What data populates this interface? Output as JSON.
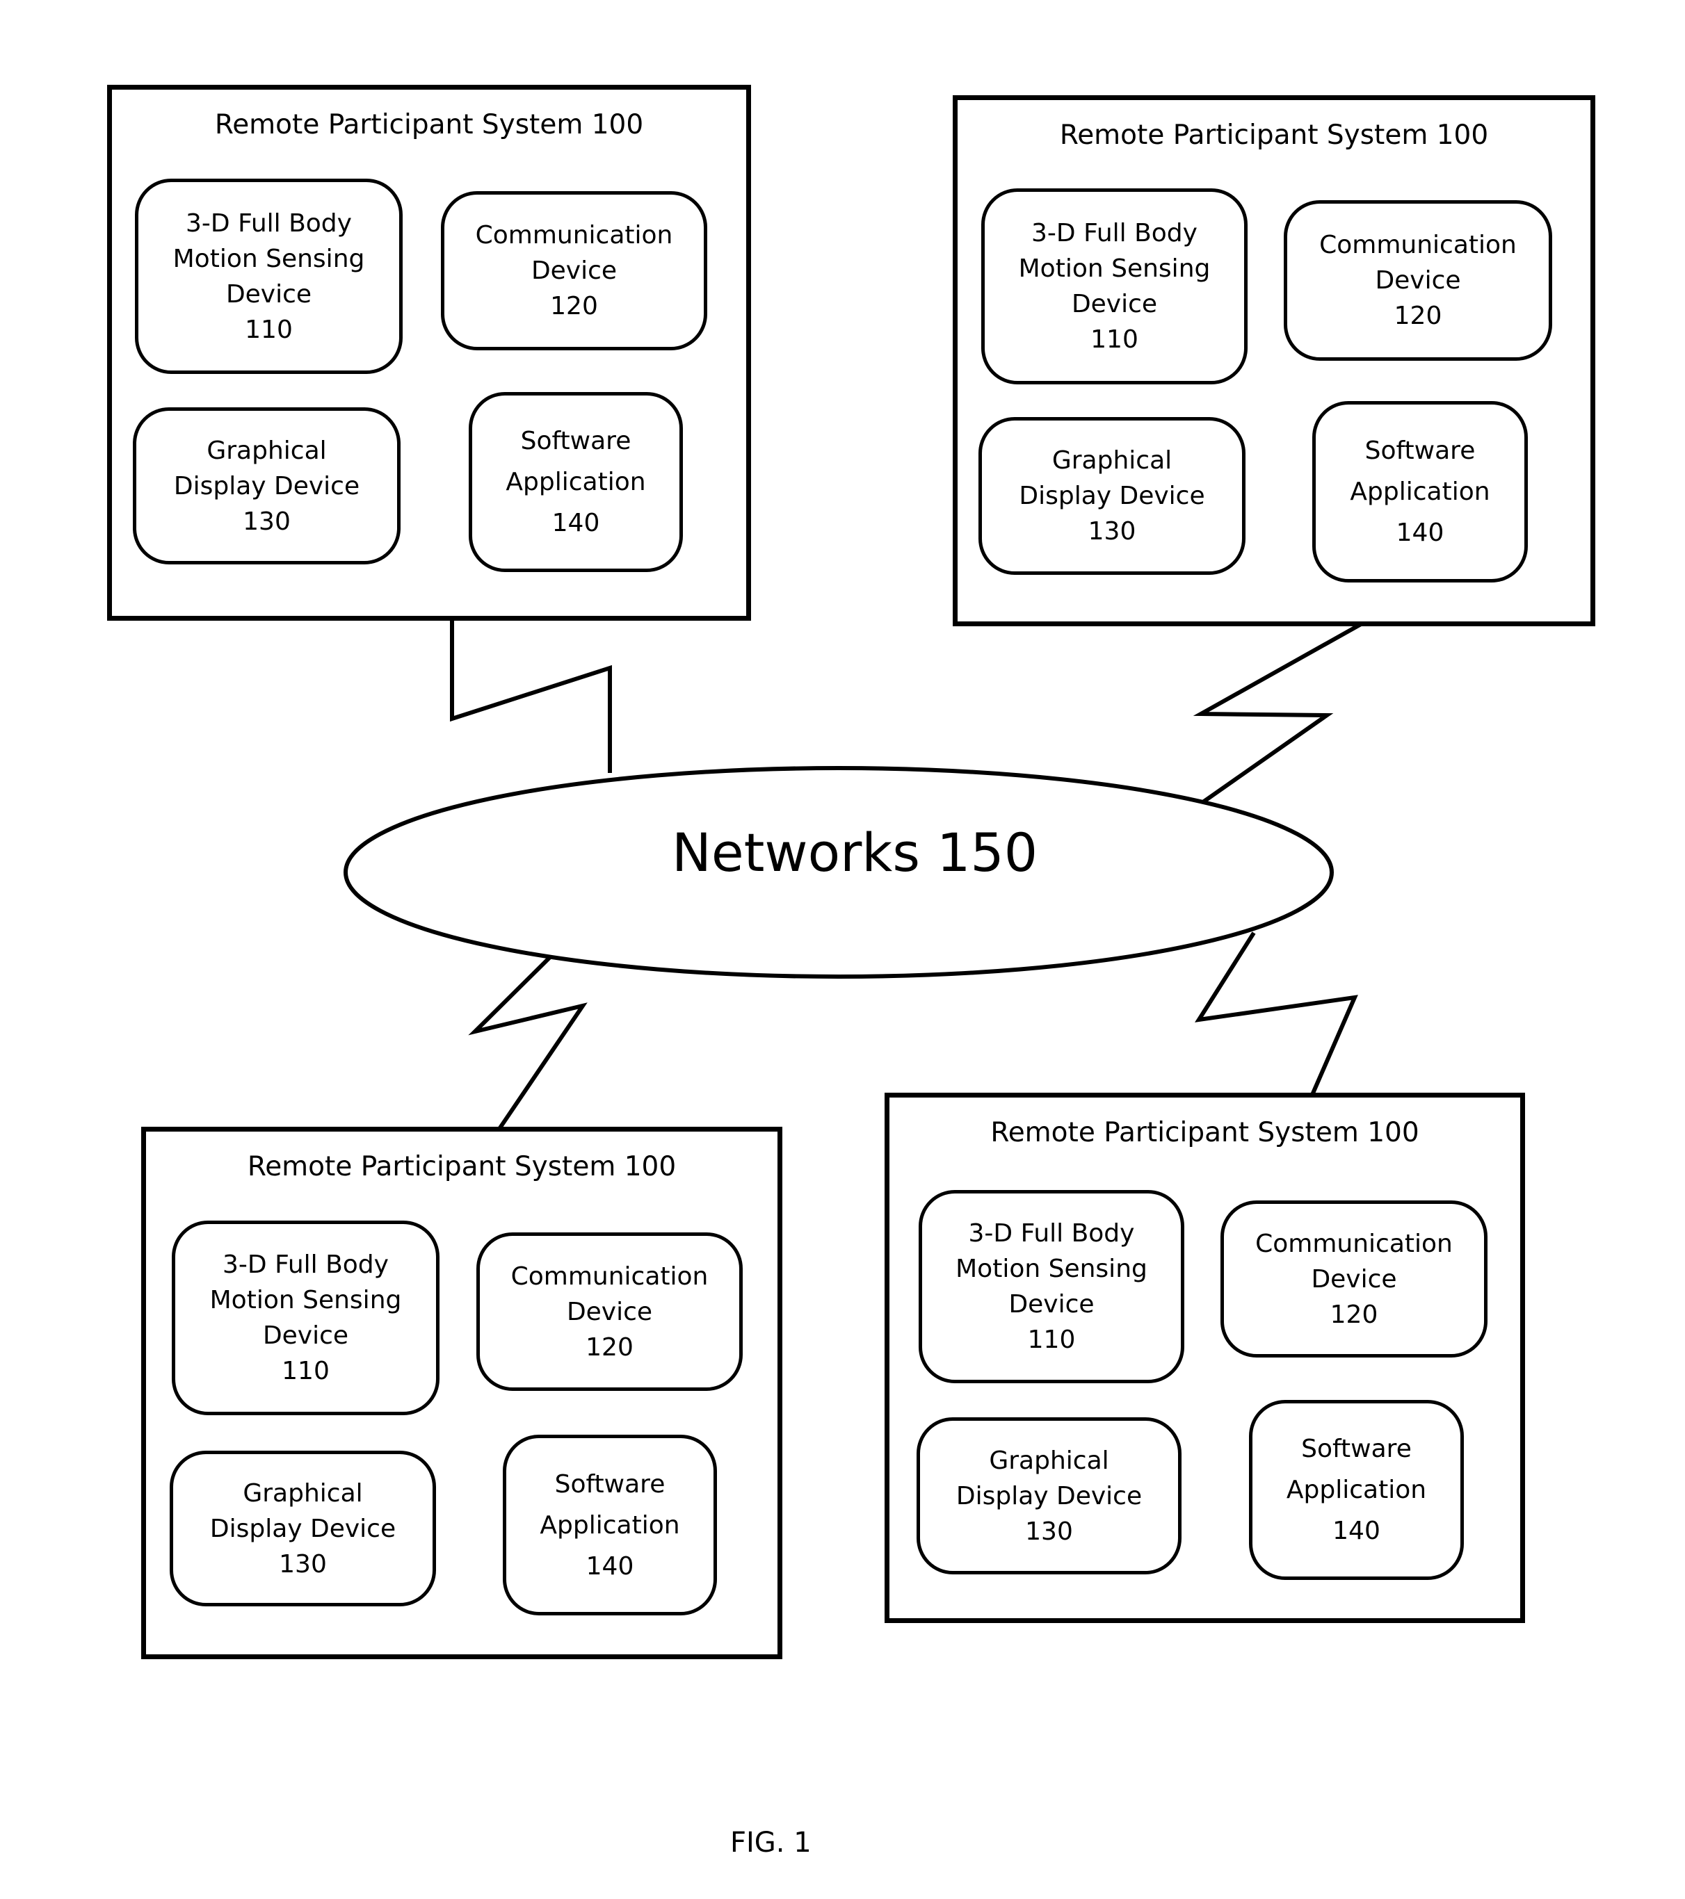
{
  "figure_label": "FIG. 1",
  "network": {
    "label": "Networks 150"
  },
  "systems": [
    {
      "position": "top-left",
      "title": "Remote Participant System 100",
      "components": [
        {
          "lines": [
            "3-D Full Body",
            "Motion Sensing",
            "Device",
            "110"
          ]
        },
        {
          "lines": [
            "Communication",
            "Device",
            "120"
          ]
        },
        {
          "lines": [
            "Graphical",
            "Display Device",
            "130"
          ]
        },
        {
          "lines": [
            "Software",
            "Application",
            "140"
          ]
        }
      ]
    },
    {
      "position": "top-right",
      "title": "Remote Participant System 100",
      "components": [
        {
          "lines": [
            "3-D Full Body",
            "Motion Sensing",
            "Device",
            "110"
          ]
        },
        {
          "lines": [
            "Communication",
            "Device",
            "120"
          ]
        },
        {
          "lines": [
            "Graphical",
            "Display Device",
            "130"
          ]
        },
        {
          "lines": [
            "Software",
            "Application",
            "140"
          ]
        }
      ]
    },
    {
      "position": "bottom-left",
      "title": "Remote Participant System 100",
      "components": [
        {
          "lines": [
            "3-D Full Body",
            "Motion Sensing",
            "Device",
            "110"
          ]
        },
        {
          "lines": [
            "Communication",
            "Device",
            "120"
          ]
        },
        {
          "lines": [
            "Graphical",
            "Display Device",
            "130"
          ]
        },
        {
          "lines": [
            "Software",
            "Application",
            "140"
          ]
        }
      ]
    },
    {
      "position": "bottom-right",
      "title": "Remote Participant System 100",
      "components": [
        {
          "lines": [
            "3-D Full Body",
            "Motion Sensing",
            "Device",
            "110"
          ]
        },
        {
          "lines": [
            "Communication",
            "Device",
            "120"
          ]
        },
        {
          "lines": [
            "Graphical",
            "Display Device",
            "130"
          ]
        },
        {
          "lines": [
            "Software",
            "Application",
            "140"
          ]
        }
      ]
    }
  ]
}
